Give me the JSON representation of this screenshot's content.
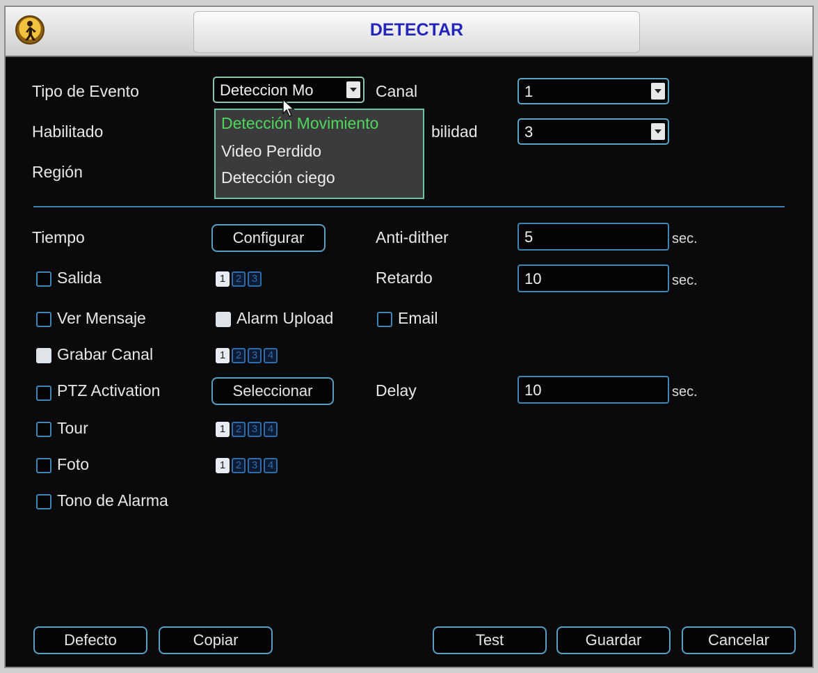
{
  "title": "DETECTAR",
  "form": {
    "tipo_evento_label": "Tipo de Evento",
    "tipo_evento_value": "Deteccion Mo",
    "canal_label": "Canal",
    "canal_value": "1",
    "habilitado_label": "Habilitado",
    "sensibilidad_label_visible": "bilidad",
    "sensibilidad_value": "3",
    "region_label": "Región"
  },
  "dropdown": {
    "options": [
      "Detección Movimiento",
      "Video Perdido",
      "Detección ciego"
    ],
    "selected_index": 0
  },
  "settings": {
    "tiempo_label": "Tiempo",
    "configurar_label": "Configurar",
    "anti_dither_label": "Anti-dither",
    "anti_dither_value": "5",
    "sec_unit": "sec.",
    "salida_label": "Salida",
    "retardo_label": "Retardo",
    "retardo_value": "10",
    "ver_mensaje_label": "Ver Mensaje",
    "alarm_upload_label": "Alarm Upload",
    "email_label": "Email",
    "grabar_canal_label": "Grabar Canal",
    "ptz_label": "PTZ Activation",
    "seleccionar_label": "Seleccionar",
    "delay_label": "Delay",
    "delay_value": "10",
    "tour_label": "Tour",
    "foto_label": "Foto",
    "tono_label": "Tono de Alarma"
  },
  "channel_numbers": [
    "1",
    "2",
    "3",
    "4"
  ],
  "checks": {
    "salida": false,
    "ver_mensaje": false,
    "alarm_upload": true,
    "email": false,
    "grabar_canal": true,
    "ptz": false,
    "tour": false,
    "foto": false,
    "tono": false
  },
  "footer": {
    "defecto": "Defecto",
    "copiar": "Copiar",
    "test": "Test",
    "guardar": "Guardar",
    "cancelar": "Cancelar"
  },
  "colors": {
    "background": "#0a0a0c",
    "title_text": "#2225b8",
    "accent_border": "#3f86b4",
    "dropdown_selected": "#4ed85a"
  }
}
